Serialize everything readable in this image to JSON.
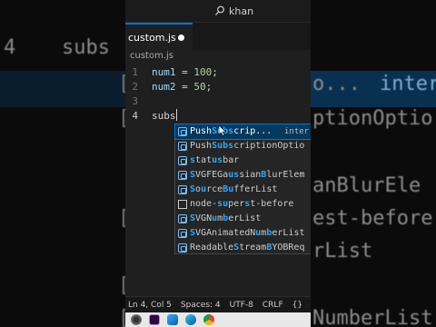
{
  "background": {
    "left_line_number": "4",
    "left_code": "subs",
    "right_texts": [
      "o...",
      "inter",
      "ptionOptio",
      "anBlurEle",
      "est-before",
      "rList",
      "NumberList"
    ]
  },
  "titlebar": {
    "search_text": "khan"
  },
  "tabs": [
    {
      "label": "custom.js",
      "modified": true
    }
  ],
  "breadcrumb": "custom.js",
  "editor": {
    "lines": [
      {
        "number": "1",
        "var": "num1",
        "op": " = ",
        "value": "100",
        "end": ";"
      },
      {
        "number": "2",
        "var": "num2",
        "op": " = ",
        "value": "50",
        "end": ";"
      },
      {
        "number": "3"
      },
      {
        "number": "4",
        "typed": "subs"
      }
    ]
  },
  "suggestions": {
    "selected_detail": "inter",
    "items": [
      {
        "label": "PushSubscrip...",
        "icon": "variable-icon"
      },
      {
        "label": "PushSubscriptionOptio",
        "icon": "variable-icon"
      },
      {
        "label": "statusbar",
        "icon": "variable-icon"
      },
      {
        "label": "SVGFEGaussianBlurElem",
        "icon": "variable-icon"
      },
      {
        "label": "SourceBufferList",
        "icon": "variable-icon"
      },
      {
        "label": "node-supertest-before",
        "icon": "text-icon"
      },
      {
        "label": "SVGNumberList",
        "icon": "variable-icon"
      },
      {
        "label": "SVGAnimatedNumberList",
        "icon": "variable-icon"
      },
      {
        "label": "ReadableStreamBYOBReq",
        "icon": "variable-icon"
      }
    ]
  },
  "statusbar": {
    "position": "Ln 4, Col 5",
    "spaces": "Spaces: 4",
    "encoding": "UTF-8",
    "eol": "CRLF",
    "braces": "{}"
  },
  "taskbar": {
    "apps": [
      "obs-icon",
      "premiere-icon",
      "vscode-icon",
      "edge-icon",
      "chrome-icon"
    ]
  },
  "colors": {
    "accent": "#0078d4",
    "match_highlight": "#2aaaff",
    "selected_bg": "#04395e"
  }
}
